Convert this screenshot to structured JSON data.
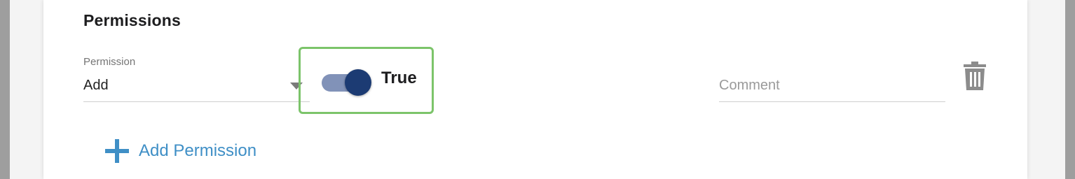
{
  "section": {
    "title": "Permissions"
  },
  "permission": {
    "label": "Permission",
    "value": "Add"
  },
  "toggle": {
    "state": true,
    "label": "True"
  },
  "comment": {
    "placeholder": "Comment",
    "value": ""
  },
  "actions": {
    "add_permission_label": "Add Permission",
    "delete_icon": "trash-icon",
    "add_icon": "plus-icon"
  },
  "colors": {
    "accent": "#3f8fc6",
    "toggle_on": "#1c3b73",
    "highlight_border": "#7cc46a"
  }
}
